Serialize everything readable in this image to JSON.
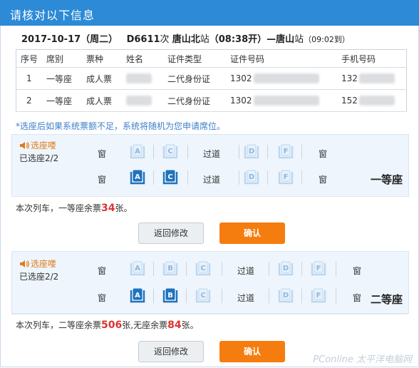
{
  "title": "请核对以下信息",
  "train": {
    "date": "2017-10-17（周二）",
    "number": "D6611",
    "number_suffix": "次",
    "from": "唐山北",
    "from_suffix": "站",
    "depart": "（08:38开）",
    "arrow": "—",
    "to": "唐山",
    "to_suffix": "站",
    "arrive": "（09:02到）"
  },
  "table": {
    "headers": [
      "序号",
      "席别",
      "票种",
      "姓名",
      "证件类型",
      "证件号码",
      "手机号码"
    ],
    "rows": [
      {
        "no": "1",
        "seat_class": "一等座",
        "ticket_type": "成人票",
        "id_type": "二代身份证",
        "id_no": "1302",
        "phone": "132"
      },
      {
        "no": "2",
        "seat_class": "一等座",
        "ticket_type": "成人票",
        "id_type": "二代身份证",
        "id_no": "1302",
        "phone": "152"
      }
    ]
  },
  "note": "*选座后如果系统票额不足，系统将随机为您申请席位。",
  "first_class": {
    "pick_label": "选座喽",
    "selected": "已选座2/2",
    "window": "窗",
    "aisle": "过道",
    "class_name": "一等座",
    "row1": [
      "A",
      "C",
      "D",
      "F"
    ],
    "row2": [
      "A",
      "C",
      "D",
      "F"
    ],
    "selected_row2": [
      "A",
      "C"
    ],
    "remain_prefix": "本次列车，一等座余票",
    "remain_count": "34",
    "remain_suffix": "张。",
    "back_label": "返回修改",
    "confirm_label": "确认"
  },
  "second_class": {
    "pick_label": "选座喽",
    "selected": "已选座2/2",
    "window": "窗",
    "aisle": "过道",
    "class_name": "二等座",
    "row1": [
      "A",
      "B",
      "C",
      "D",
      "F"
    ],
    "row2": [
      "A",
      "B",
      "C",
      "D",
      "F"
    ],
    "selected_row2": [
      "A",
      "B"
    ],
    "remain_prefix": "本次列车，二等座余票",
    "remain_count": "506",
    "remain_mid": "张,无座余票",
    "noseat_count": "84",
    "remain_suffix": "张。",
    "back_label": "返回修改",
    "confirm_label": "确认"
  },
  "watermark": "PConline 太平洋电脑网",
  "colors": {
    "header": "#2c8ad6",
    "selected_seat": "#1e73be",
    "free_seat": "#bcd7f0",
    "accent": "#f57c0e",
    "count": "#dd3333"
  }
}
